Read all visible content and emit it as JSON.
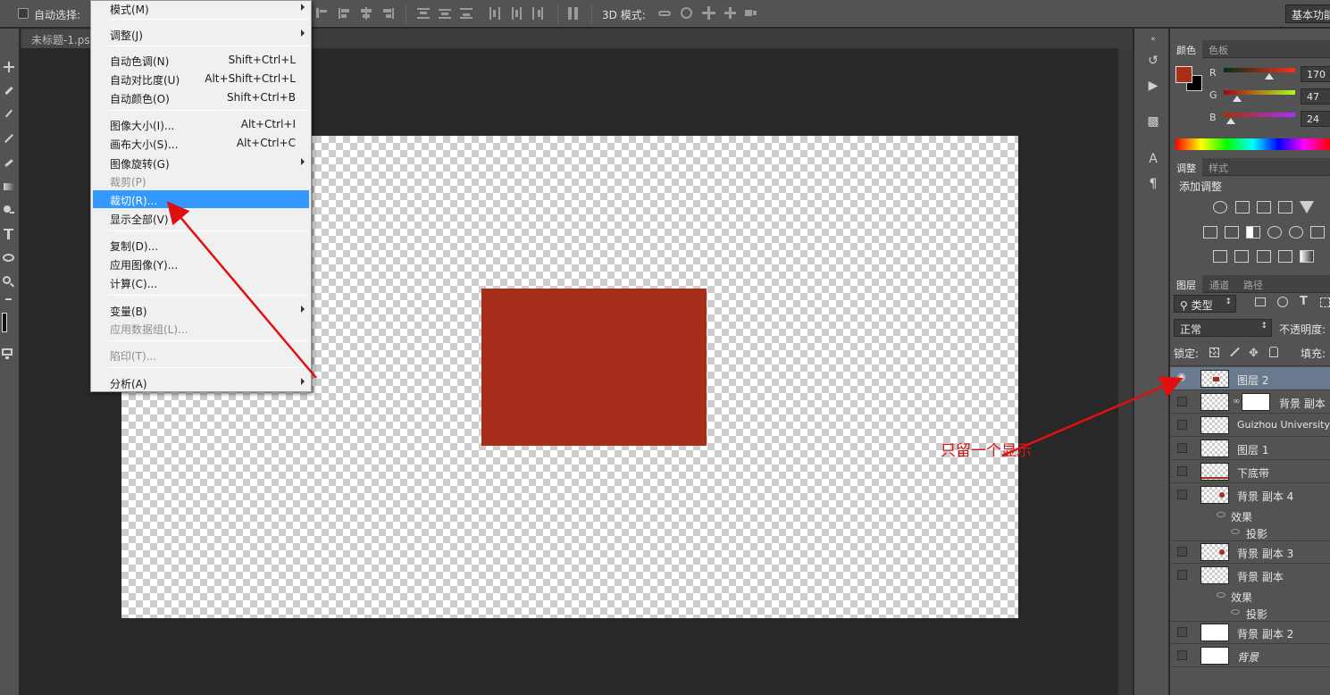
{
  "options_bar": {
    "auto_select_label": "自动选择:",
    "mode_3d_label": "3D 模式:",
    "workspace_label": "基本功能"
  },
  "document": {
    "tab_title": "未标题-1.psd"
  },
  "image_menu": {
    "items": [
      {
        "label": "模式(M)",
        "shortcut": "",
        "submenu": true,
        "disabled": false
      },
      {
        "label": "调整(J)",
        "shortcut": "",
        "submenu": true,
        "disabled": false
      },
      {
        "label": "自动色调(N)",
        "shortcut": "Shift+Ctrl+L",
        "submenu": false,
        "disabled": false
      },
      {
        "label": "自动对比度(U)",
        "shortcut": "Alt+Shift+Ctrl+L",
        "submenu": false,
        "disabled": false
      },
      {
        "label": "自动颜色(O)",
        "shortcut": "Shift+Ctrl+B",
        "submenu": false,
        "disabled": false
      },
      {
        "label": "图像大小(I)...",
        "shortcut": "Alt+Ctrl+I",
        "submenu": false,
        "disabled": false
      },
      {
        "label": "画布大小(S)...",
        "shortcut": "Alt+Ctrl+C",
        "submenu": false,
        "disabled": false
      },
      {
        "label": "图像旋转(G)",
        "shortcut": "",
        "submenu": true,
        "disabled": false
      },
      {
        "label": "裁剪(P)",
        "shortcut": "",
        "submenu": false,
        "disabled": true
      },
      {
        "label": "裁切(R)...",
        "shortcut": "",
        "submenu": false,
        "disabled": false,
        "highlighted": true
      },
      {
        "label": "显示全部(V)",
        "shortcut": "",
        "submenu": false,
        "disabled": false
      },
      {
        "label": "复制(D)...",
        "shortcut": "",
        "submenu": false,
        "disabled": false
      },
      {
        "label": "应用图像(Y)...",
        "shortcut": "",
        "submenu": false,
        "disabled": false
      },
      {
        "label": "计算(C)...",
        "shortcut": "",
        "submenu": false,
        "disabled": false
      },
      {
        "label": "变量(B)",
        "shortcut": "",
        "submenu": true,
        "disabled": false
      },
      {
        "label": "应用数据组(L)...",
        "shortcut": "",
        "submenu": false,
        "disabled": true
      },
      {
        "label": "陷印(T)...",
        "shortcut": "",
        "submenu": false,
        "disabled": true
      },
      {
        "label": "分析(A)",
        "shortcut": "",
        "submenu": true,
        "disabled": false
      }
    ]
  },
  "color_panel": {
    "tabs": [
      "颜色",
      "色板"
    ],
    "foreground_color": "#aa2f18",
    "channels": [
      {
        "label": "R",
        "value": "170"
      },
      {
        "label": "G",
        "value": "47"
      },
      {
        "label": "B",
        "value": "24"
      }
    ]
  },
  "adjustments_panel": {
    "tabs": [
      "调整",
      "样式"
    ],
    "heading": "添加调整"
  },
  "layers_panel": {
    "tabs": [
      "图层",
      "通道",
      "路径"
    ],
    "filter_label": "类型",
    "blend_mode": "正常",
    "opacity_label": "不透明度:",
    "lock_label": "锁定:",
    "fill_label": "填充:",
    "layers": [
      {
        "name": "图层 2",
        "selected": true,
        "visible": true
      },
      {
        "name": "背景 副本",
        "selected": false,
        "visible": false
      },
      {
        "name": "Guizhou University",
        "selected": false,
        "visible": false
      },
      {
        "name": "图层 1",
        "selected": false,
        "visible": false
      },
      {
        "name": "下底带",
        "selected": false,
        "visible": false
      },
      {
        "name": "背景 副本 4",
        "selected": false,
        "visible": false
      },
      {
        "name": "背景 副本 3",
        "selected": false,
        "visible": false
      },
      {
        "name": "背景 副本",
        "selected": false,
        "visible": false
      },
      {
        "name": "背景 副本 2",
        "selected": false,
        "visible": false
      },
      {
        "name": "背景",
        "selected": false,
        "visible": false
      }
    ],
    "effects_label": "效果",
    "drop_shadow_label": "投影"
  },
  "annotation": {
    "text": "只留一个显示",
    "color": "#d01818"
  },
  "canvas_fill_color": "#a82e1c"
}
